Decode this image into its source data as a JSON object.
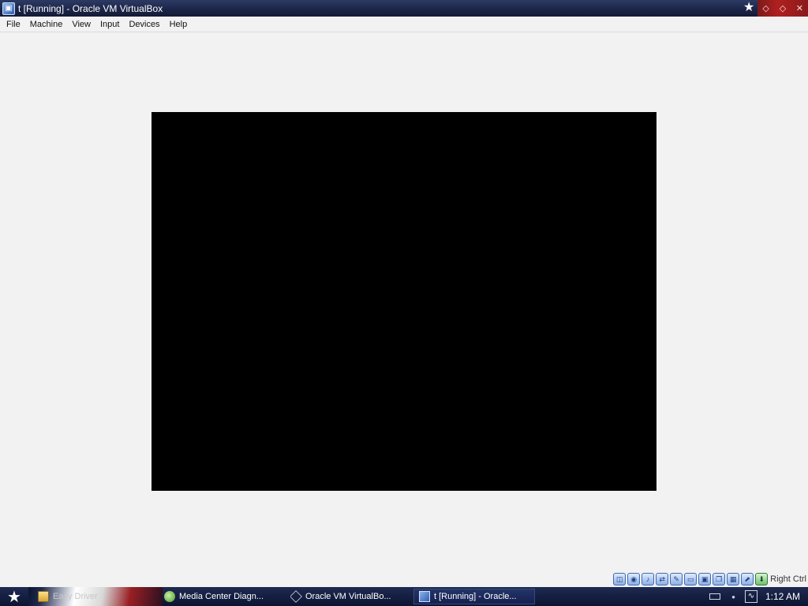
{
  "window": {
    "title": "t [Running] - Oracle VM VirtualBox"
  },
  "menu": {
    "items": [
      "File",
      "Machine",
      "View",
      "Input",
      "Devices",
      "Help"
    ]
  },
  "statusbar": {
    "icons": [
      "hard-disk-icon",
      "optical-drive-icon",
      "audio-icon",
      "network-icon",
      "usb-icon",
      "shared-folders-icon",
      "display-icon",
      "video-capture-icon",
      "cpu-icon",
      "mouse-integration-icon",
      "keyboard-capture-icon"
    ],
    "host_key": "Right Ctrl"
  },
  "taskbar": {
    "quick_launch": "Easy Driver",
    "tasks": [
      {
        "label": "Media Center Diagn..."
      },
      {
        "label": "Oracle VM VirtualBo..."
      },
      {
        "label": "t [Running] - Oracle..."
      }
    ],
    "clock": "1:12 AM"
  },
  "colors": {
    "vm_screen": "#000000",
    "background": "#f2f2f2",
    "titlebar": "#1b2447",
    "taskbar": "#0c1431"
  }
}
